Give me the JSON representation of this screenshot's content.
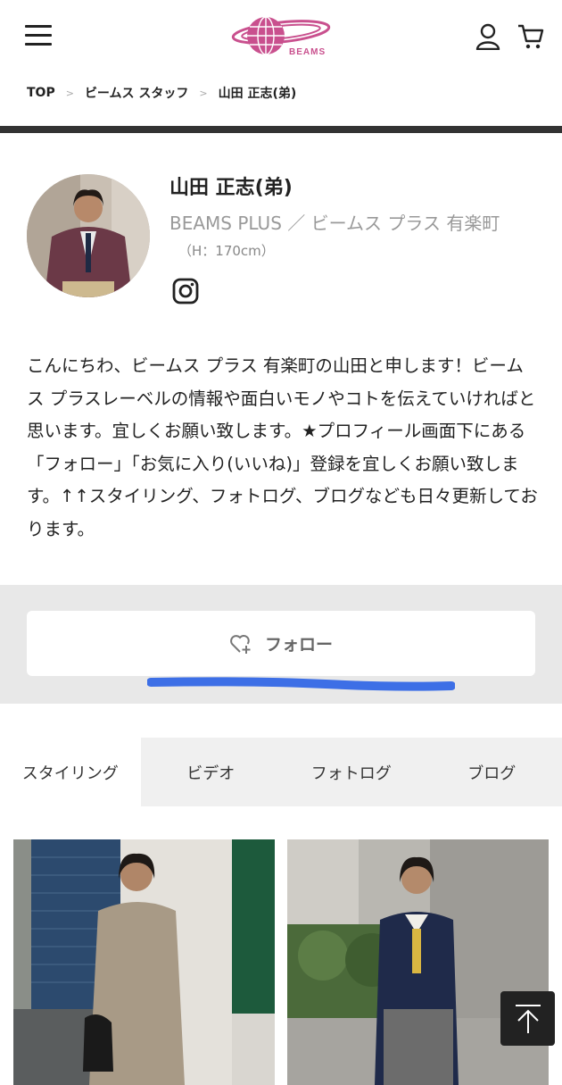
{
  "brand": {
    "name": "BEAMS",
    "logo_color": "#c9508e"
  },
  "header": {
    "menu_icon": "hamburger-menu-icon",
    "account_icon": "user-icon",
    "cart_icon": "cart-icon"
  },
  "breadcrumb": {
    "items": [
      "TOP",
      "ビームス スタッフ",
      "山田 正志(弟)"
    ],
    "separator": ">"
  },
  "profile": {
    "name": "山田 正志(弟)",
    "shop": "BEAMS PLUS ／ ビームス プラス 有楽町",
    "height": "（H：170cm）",
    "social_icon": "instagram-icon",
    "bio": "こんにちわ、ビームス プラス 有楽町の山田と申します！ビームス プラスレーベルの情報や面白いモノやコトを伝えていければと思います。宜しくお願い致します。★プロフィール画面下にある「フォロー」「お気に入り(いいね)」登録を宜しくお願い致します。↑↑スタイリング、フォトログ、ブログなども日々更新しております。"
  },
  "follow": {
    "label": "フォロー",
    "icon": "heart-plus-icon",
    "highlight_color": "#3d6fe6"
  },
  "tabs": [
    {
      "label": "スタイリング",
      "active": true
    },
    {
      "label": "ビデオ",
      "active": false
    },
    {
      "label": "フォトログ",
      "active": false
    },
    {
      "label": "ブログ",
      "active": false
    }
  ],
  "gallery": {
    "items": [
      "styling-photo",
      "styling-photo"
    ]
  },
  "scroll_top": {
    "icon": "arrow-up-icon"
  }
}
